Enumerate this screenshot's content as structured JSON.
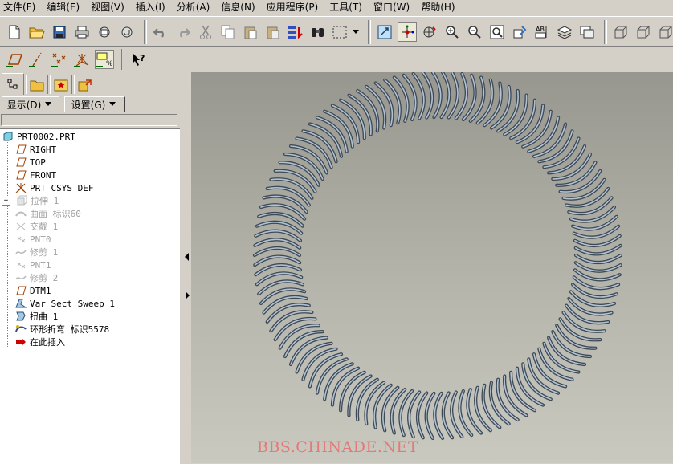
{
  "menubar": {
    "items": [
      "文件(F)",
      "编辑(E)",
      "视图(V)",
      "插入(I)",
      "分析(A)",
      "信息(N)",
      "应用程序(P)",
      "工具(T)",
      "窗口(W)",
      "帮助(H)"
    ]
  },
  "toolbar": {
    "row1_icons": [
      "new-icon",
      "open-icon",
      "save-icon",
      "print-icon",
      "send-mail-icon",
      "mail-attach-icon",
      "undo-icon",
      "redo-icon",
      "cut-icon",
      "copy-icon",
      "paste-icon",
      "paste-special-icon",
      "regenerate-icon",
      "find-icon",
      "select-box-icon",
      "orient-icon",
      "spin-center-icon",
      "saved-views-icon",
      "zoom-in-icon",
      "zoom-out-icon",
      "refit-icon",
      "repaint-icon",
      "model-tree-icon",
      "layers-icon",
      "named-views-icon",
      "wireframe-icon",
      "hidden-line-icon",
      "shaded-icon"
    ],
    "row2_icons": [
      "datum-planes-icon",
      "datum-axes-icon",
      "datum-points-icon",
      "coordinate-systems-icon",
      "annotation-display-icon",
      "whats-this-icon"
    ]
  },
  "panel": {
    "tabs": [
      "model-tree-tab",
      "folder-browser-tab",
      "favorites-tab",
      "connections-tab"
    ],
    "show_label": "显示(D)",
    "settings_label": "设置(G)",
    "tree": {
      "root": "PRT0002.PRT",
      "items": [
        {
          "label": "RIGHT",
          "icon": "datum-plane-icon",
          "dim": false
        },
        {
          "label": "TOP",
          "icon": "datum-plane-icon",
          "dim": false
        },
        {
          "label": "FRONT",
          "icon": "datum-plane-icon",
          "dim": false
        },
        {
          "label": "PRT_CSYS_DEF",
          "icon": "csys-icon",
          "dim": false
        },
        {
          "label": "拉伸 1",
          "icon": "extrude-icon",
          "dim": true,
          "expandable": true
        },
        {
          "label": "曲面 标识60",
          "icon": "surface-icon",
          "dim": true
        },
        {
          "label": "交截 1",
          "icon": "intersect-icon",
          "dim": true
        },
        {
          "label": "PNT0",
          "icon": "datum-point-icon",
          "dim": true
        },
        {
          "label": "修剪 1",
          "icon": "trim-icon",
          "dim": true
        },
        {
          "label": "PNT1",
          "icon": "datum-point-icon",
          "dim": true
        },
        {
          "label": "修剪 2",
          "icon": "trim-icon",
          "dim": true
        },
        {
          "label": "DTM1",
          "icon": "datum-plane-icon",
          "dim": false
        },
        {
          "label": "Var Sect Sweep 1",
          "icon": "var-sect-sweep-icon",
          "dim": false
        },
        {
          "label": "扭曲 1",
          "icon": "warp-icon",
          "dim": false
        },
        {
          "label": "环形折弯 标识5578",
          "icon": "toroidal-bend-icon",
          "dim": false
        },
        {
          "label": "在此插入",
          "icon": "insert-here-arrow-icon",
          "dim": false
        }
      ]
    }
  },
  "viewport": {
    "model": "toroidal-spring-coil",
    "background_top": "#97978f",
    "background_bottom": "#c9c9c0"
  },
  "watermark": "BBS.CHINADE.NET"
}
